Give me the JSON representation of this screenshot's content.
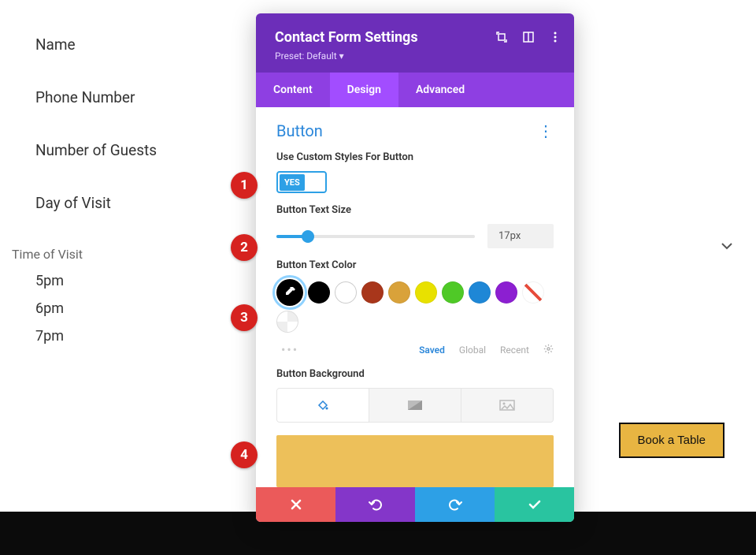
{
  "form": {
    "name": "Name",
    "phone": "Phone Number",
    "guests": "Number of Guests",
    "day": "Day of Visit",
    "time_title": "Time of Visit",
    "times": [
      "5pm",
      "6pm",
      "7pm"
    ]
  },
  "book_button": "Book a Table",
  "panel": {
    "title": "Contact Form Settings",
    "preset": "Preset: Default ▾",
    "tabs": {
      "content": "Content",
      "design": "Design",
      "advanced": "Advanced"
    },
    "section": "Button",
    "custom_styles": {
      "label": "Use Custom Styles For Button",
      "toggle": "YES"
    },
    "text_size": {
      "label": "Button Text Size",
      "value": "17px"
    },
    "text_color": {
      "label": "Button Text Color",
      "swatches": [
        "#000000",
        "#000000",
        "#ffffff",
        "#a8361b",
        "#d9a23a",
        "#e8e100",
        "#4fc927",
        "#1e87d6",
        "#8c1fd1"
      ],
      "tabs": {
        "saved": "Saved",
        "global": "Global",
        "recent": "Recent"
      }
    },
    "background": {
      "label": "Button Background",
      "preview_color": "#edc05a"
    }
  },
  "markers": {
    "m1": "1",
    "m2": "2",
    "m3": "3",
    "m4": "4"
  }
}
